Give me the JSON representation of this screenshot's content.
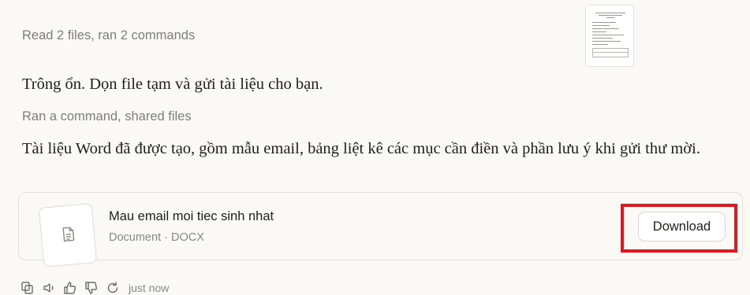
{
  "activity": {
    "files_summary": "Read 2 files, ran 2 commands",
    "command_summary": "Ran a command, shared files"
  },
  "message": {
    "line1": "Trông ổn. Dọn file tạm và gửi tài liệu cho bạn.",
    "line2": "Tài liệu Word đã được tạo, gồm mẫu email, bảng liệt kê các mục cần điền và phần lưu ý khi gửi thư mời."
  },
  "file_card": {
    "name": "Mau email moi tiec sinh nhat",
    "meta": "Document · DOCX",
    "download_label": "Download",
    "highlight_color": "#e3161f"
  },
  "actions": {
    "icons": [
      "copy-icon",
      "speaker-icon",
      "thumbs-up-icon",
      "thumbs-down-icon",
      "retry-icon"
    ],
    "timestamp": "just now"
  }
}
